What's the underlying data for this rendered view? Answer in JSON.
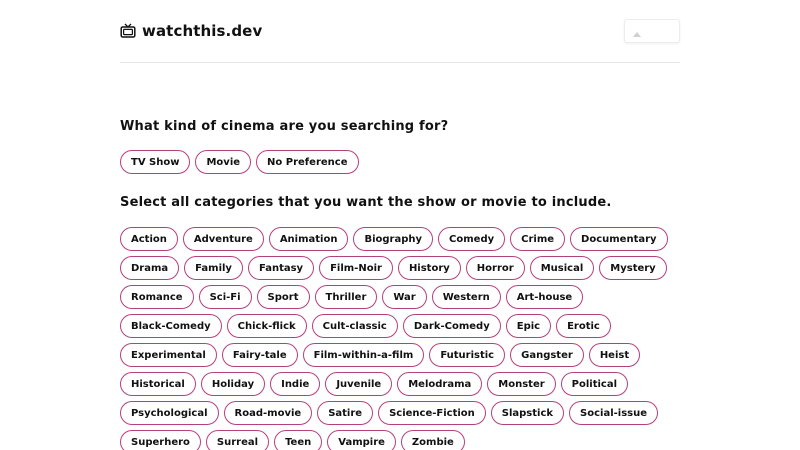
{
  "header": {
    "site_name": "watchthis.dev",
    "logo_icon": "tv-icon",
    "theme_toggle_icon": "triangle-up-icon"
  },
  "colors": {
    "accent": "#b5407e",
    "text": "#111111",
    "divider": "#e6e6e6"
  },
  "media_question": "What kind of cinema are you searching for?",
  "media_types": [
    "TV Show",
    "Movie",
    "No Preference"
  ],
  "category_question": "Select all categories that you want the show or movie to include.",
  "categories": [
    "Action",
    "Adventure",
    "Animation",
    "Biography",
    "Comedy",
    "Crime",
    "Documentary",
    "Drama",
    "Family",
    "Fantasy",
    "Film-Noir",
    "History",
    "Horror",
    "Musical",
    "Mystery",
    "Romance",
    "Sci-Fi",
    "Sport",
    "Thriller",
    "War",
    "Western",
    "Art-house",
    "Black-Comedy",
    "Chick-flick",
    "Cult-classic",
    "Dark-Comedy",
    "Epic",
    "Erotic",
    "Experimental",
    "Fairy-tale",
    "Film-within-a-film",
    "Futuristic",
    "Gangster",
    "Heist",
    "Historical",
    "Holiday",
    "Indie",
    "Juvenile",
    "Melodrama",
    "Monster",
    "Political",
    "Psychological",
    "Road-movie",
    "Satire",
    "Science-Fiction",
    "Slapstick",
    "Social-issue",
    "Superhero",
    "Surreal",
    "Teen",
    "Vampire",
    "Zombie"
  ]
}
